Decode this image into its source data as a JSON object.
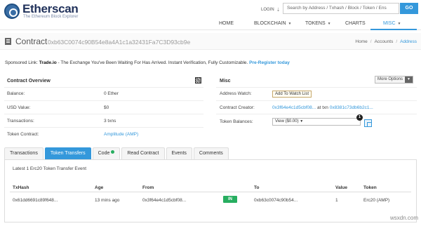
{
  "header": {
    "logo_name": "Etherscan",
    "logo_tagline": "The Ethereum Block Explorer",
    "login_label": "LOGIN",
    "search_placeholder": "Search by Address / Txhash / Block / Token / Ens",
    "go_label": "GO"
  },
  "nav": {
    "items": [
      {
        "label": "HOME"
      },
      {
        "label": "BLOCKCHAIN"
      },
      {
        "label": "TOKENS"
      },
      {
        "label": "CHARTS"
      },
      {
        "label": "MISC"
      }
    ],
    "active": "MISC"
  },
  "title": {
    "label": "Contract",
    "address": "0xb63C0074c90B54e8a4A1c1a32431Fa7C3D93cb9e"
  },
  "breadcrumb": [
    "Home",
    "Accounts",
    "Address"
  ],
  "sponsored": {
    "prefix": "Sponsored Link:",
    "brand": "Trade.io",
    "text": " - The Exchange You've Been Waiting For Has Arrived. Instant Verification, Fully Customizable. ",
    "cta": "Pre-Register today"
  },
  "overview": {
    "title": "Contract Overview",
    "rows": [
      {
        "label": "Balance:",
        "value": "0 Ether"
      },
      {
        "label": "USD Value:",
        "value": "$0"
      },
      {
        "label": "Transactions:",
        "value": "3 txns"
      },
      {
        "label": "Token Contract:",
        "value": "Amplitude (AMP)"
      }
    ]
  },
  "misc": {
    "title": "Misc",
    "more_options": "More Options",
    "address_watch_label": "Address Watch:",
    "watch_button": "Add To Watch List",
    "creator_label": "Contract Creator:",
    "creator_address": "0x3f64e4c1d5cbf08...",
    "creator_at": "at txn",
    "creator_txn": "0x8381c73db6b2c1...",
    "balances_label": "Token Balances:",
    "balances_select": "View ($0.00)",
    "badge_count": "1"
  },
  "tabs": [
    {
      "label": "Transactions",
      "active": false
    },
    {
      "label": "Token Transfers",
      "active": true
    },
    {
      "label": "Code",
      "active": false,
      "verified": true
    },
    {
      "label": "Read Contract",
      "active": false
    },
    {
      "label": "Events",
      "active": false
    },
    {
      "label": "Comments",
      "active": false
    }
  ],
  "transfers": {
    "summary": "Latest 1 Erc20 Token Transfer Event",
    "columns": [
      "TxHash",
      "Age",
      "From",
      "",
      "To",
      "Value",
      "Token"
    ],
    "rows": [
      {
        "txhash": "0x61dd6691c89f648...",
        "age": "13 mins ago",
        "from": "0x3f64e4c1d5cbf08...",
        "direction": "IN",
        "to": "0xb63c0074c90b54...",
        "value": "1",
        "token": "Erc20 (AMP)"
      }
    ]
  },
  "watermark": "wsxdn.com",
  "colors": {
    "accent": "#3498db",
    "in_badge": "#27ae60",
    "brand": "#21325b"
  }
}
